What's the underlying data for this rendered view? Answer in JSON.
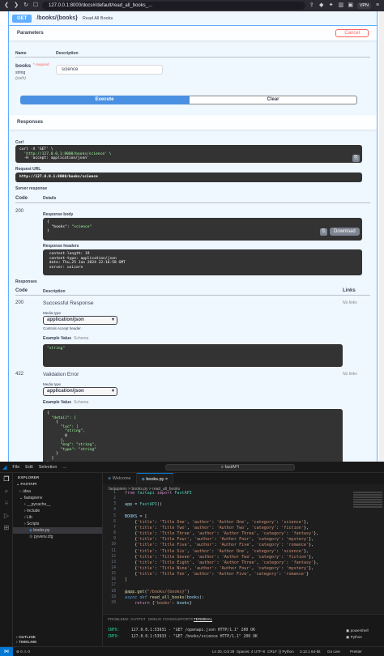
{
  "browser": {
    "url": "127.0.0.1:8000/docs#/default/read_all_books_...",
    "vpn": "VPN"
  },
  "operation": {
    "method": "GET",
    "path": "/books/{books}",
    "summary": "Read All Books"
  },
  "parameters": {
    "title": "Parameters",
    "cancel_label": "Cancel",
    "col_name": "Name",
    "col_description": "Description",
    "param_name": "books",
    "param_required": "* required",
    "param_type": "string",
    "param_in": "(path)",
    "param_value": "science",
    "execute_label": "Execute",
    "clear_label": "Clear"
  },
  "responses_section": {
    "title": "Responses",
    "curl_label": "Curl",
    "curl_line1": "curl -X 'GET' \\",
    "curl_line2": "  'http://127.0.0.1:8000/books/science' \\",
    "curl_line3": "  -H 'accept: application/json'",
    "request_url_label": "Request URL",
    "request_url": "http://127.0.0.1:8000/books/science",
    "server_response_label": "Server response",
    "col_code": "Code",
    "col_details": "Details",
    "code": "200",
    "response_body_label": "Response body",
    "body_line1": "{",
    "body_line2_key": "  \"books\": ",
    "body_line2_val": "\"science\"",
    "body_line3": "}",
    "download_label": "Download",
    "response_headers_label": "Response headers",
    "headers": [
      " content-length: 19",
      " content-type: application/json",
      " date: Thu,25 Jan 2024 22:16:58 GMT",
      " server: uvicorn"
    ]
  },
  "documented_responses": {
    "title": "Responses",
    "col_code": "Code",
    "col_description": "Description",
    "col_links": "Links",
    "r200_code": "200",
    "r200_desc": "Successful Response",
    "r200_links": "No links",
    "media_type_label": "Media type",
    "media_type_value": "application/json",
    "controls_accept": "Controls Accept header.",
    "example_value_label": "Example Value",
    "schema_label": "Schema",
    "r200_example": "\"string\"",
    "r422_code": "422",
    "r422_desc": "Validation Error",
    "r422_links": "No links",
    "r422_example_lines": [
      "{",
      "  \"detail\": [",
      "    {",
      "      \"loc\": [",
      "        \"string\",",
      "        0",
      "      ],",
      "      \"msg\": \"string\",",
      "      \"type\": \"string\"",
      "    }",
      "  ]",
      "}"
    ]
  },
  "vscode": {
    "menu": [
      "File",
      "Edit",
      "Selection",
      "..."
    ],
    "command_center": "fastAPI",
    "explorer_title": "EXPLORER",
    "project": "FASTAPI",
    "tree": [
      ".idea",
      "fastapienv",
      "__pycache__",
      "Include",
      "Lib",
      "Scripts",
      "books.py",
      "pyvenv.cfg"
    ],
    "outline": "OUTLINE",
    "timeline": "TIMELINE",
    "tabs": [
      "Welcome",
      "books.py"
    ],
    "breadcrumb": "fastapienv > books.py > read_all_books",
    "code_lines": [
      {
        "n": "1",
        "parts": [
          [
            "kw",
            "from "
          ],
          [
            "cls",
            "fastapi "
          ],
          [
            "kw",
            "import "
          ],
          [
            "cls",
            "FastAPI"
          ]
        ]
      },
      {
        "n": "2",
        "parts": []
      },
      {
        "n": "3",
        "parts": [
          [
            "vr",
            "app "
          ],
          [
            "op",
            "= "
          ],
          [
            "cls",
            "FastAPI"
          ],
          [
            "op",
            "()"
          ]
        ]
      },
      {
        "n": "4",
        "parts": []
      },
      {
        "n": "5",
        "parts": [
          [
            "vr",
            "BOOKS "
          ],
          [
            "op",
            "= ["
          ]
        ]
      },
      {
        "n": "6",
        "parts": [
          [
            "op",
            "    {"
          ],
          [
            "s",
            "'title'"
          ],
          [
            "op",
            ": "
          ],
          [
            "s",
            "'Title One'"
          ],
          [
            "op",
            ", "
          ],
          [
            "s",
            "'author'"
          ],
          [
            "op",
            ": "
          ],
          [
            "s",
            "'Author One'"
          ],
          [
            "op",
            ", "
          ],
          [
            "s",
            "'category'"
          ],
          [
            "op",
            ": "
          ],
          [
            "s",
            "'science'"
          ],
          [
            "op",
            "},"
          ]
        ]
      },
      {
        "n": "7",
        "parts": [
          [
            "op",
            "    {"
          ],
          [
            "s",
            "'title'"
          ],
          [
            "op",
            ": "
          ],
          [
            "s",
            "'Title Two'"
          ],
          [
            "op",
            ", "
          ],
          [
            "s",
            "'author'"
          ],
          [
            "op",
            ": "
          ],
          [
            "s",
            "'Author Two'"
          ],
          [
            "op",
            ", "
          ],
          [
            "s",
            "'category'"
          ],
          [
            "op",
            ": "
          ],
          [
            "s",
            "'fiction'"
          ],
          [
            "op",
            "},"
          ]
        ]
      },
      {
        "n": "8",
        "parts": [
          [
            "op",
            "    {"
          ],
          [
            "s",
            "'title'"
          ],
          [
            "op",
            ": "
          ],
          [
            "s",
            "'Title Three'"
          ],
          [
            "op",
            ", "
          ],
          [
            "s",
            "'author'"
          ],
          [
            "op",
            ": "
          ],
          [
            "s",
            "'Author Three'"
          ],
          [
            "op",
            ", "
          ],
          [
            "s",
            "'category'"
          ],
          [
            "op",
            ": "
          ],
          [
            "s",
            "'fantasy'"
          ],
          [
            "op",
            "},"
          ]
        ]
      },
      {
        "n": "9",
        "parts": [
          [
            "op",
            "    {"
          ],
          [
            "s",
            "'title'"
          ],
          [
            "op",
            ": "
          ],
          [
            "s",
            "'Title Four'"
          ],
          [
            "op",
            ", "
          ],
          [
            "s",
            "'author'"
          ],
          [
            "op",
            ": "
          ],
          [
            "s",
            "'Author Four'"
          ],
          [
            "op",
            ", "
          ],
          [
            "s",
            "'category'"
          ],
          [
            "op",
            ": "
          ],
          [
            "s",
            "'mystery'"
          ],
          [
            "op",
            "},"
          ]
        ]
      },
      {
        "n": "10",
        "parts": [
          [
            "op",
            "    {"
          ],
          [
            "s",
            "'title'"
          ],
          [
            "op",
            ": "
          ],
          [
            "s",
            "'Title Five'"
          ],
          [
            "op",
            ", "
          ],
          [
            "s",
            "'author'"
          ],
          [
            "op",
            ": "
          ],
          [
            "s",
            "'Author Five'"
          ],
          [
            "op",
            ", "
          ],
          [
            "s",
            "'category'"
          ],
          [
            "op",
            ": "
          ],
          [
            "s",
            "'romance'"
          ],
          [
            "op",
            "},"
          ]
        ]
      },
      {
        "n": "11",
        "parts": [
          [
            "op",
            "    {"
          ],
          [
            "s",
            "'title'"
          ],
          [
            "op",
            ": "
          ],
          [
            "s",
            "'Title Six'"
          ],
          [
            "op",
            ", "
          ],
          [
            "s",
            "'author'"
          ],
          [
            "op",
            ": "
          ],
          [
            "s",
            "'Author One'"
          ],
          [
            "op",
            ", "
          ],
          [
            "s",
            "'category'"
          ],
          [
            "op",
            ": "
          ],
          [
            "s",
            "'science'"
          ],
          [
            "op",
            "},"
          ]
        ]
      },
      {
        "n": "12",
        "parts": [
          [
            "op",
            "    {"
          ],
          [
            "s",
            "'title'"
          ],
          [
            "op",
            ": "
          ],
          [
            "s",
            "'Title Seven'"
          ],
          [
            "op",
            ", "
          ],
          [
            "s",
            "'author'"
          ],
          [
            "op",
            ": "
          ],
          [
            "s",
            "'Author Two'"
          ],
          [
            "op",
            ", "
          ],
          [
            "s",
            "'category'"
          ],
          [
            "op",
            ": "
          ],
          [
            "s",
            "'fiction'"
          ],
          [
            "op",
            "},"
          ]
        ]
      },
      {
        "n": "13",
        "parts": [
          [
            "op",
            "    {"
          ],
          [
            "s",
            "'title'"
          ],
          [
            "op",
            ": "
          ],
          [
            "s",
            "'Title Eight'"
          ],
          [
            "op",
            ", "
          ],
          [
            "s",
            "'author'"
          ],
          [
            "op",
            ": "
          ],
          [
            "s",
            "'Author Three'"
          ],
          [
            "op",
            ", "
          ],
          [
            "s",
            "'category'"
          ],
          [
            "op",
            ": "
          ],
          [
            "s",
            "'fantasy'"
          ],
          [
            "op",
            "},"
          ]
        ]
      },
      {
        "n": "14",
        "parts": [
          [
            "op",
            "    {"
          ],
          [
            "s",
            "'title'"
          ],
          [
            "op",
            ": "
          ],
          [
            "s",
            "'Title Nine'"
          ],
          [
            "op",
            ", "
          ],
          [
            "s",
            "'author'"
          ],
          [
            "op",
            ": "
          ],
          [
            "s",
            "'Author Four'"
          ],
          [
            "op",
            ", "
          ],
          [
            "s",
            "'category'"
          ],
          [
            "op",
            ": "
          ],
          [
            "s",
            "'mystery'"
          ],
          [
            "op",
            "},"
          ]
        ]
      },
      {
        "n": "15",
        "parts": [
          [
            "op",
            "    {"
          ],
          [
            "s",
            "'title'"
          ],
          [
            "op",
            ": "
          ],
          [
            "s",
            "'Title Ten'"
          ],
          [
            "op",
            ", "
          ],
          [
            "s",
            "'author'"
          ],
          [
            "op",
            ": "
          ],
          [
            "s",
            "'Author Five'"
          ],
          [
            "op",
            ", "
          ],
          [
            "s",
            "'category'"
          ],
          [
            "op",
            ": "
          ],
          [
            "s",
            "'romance'"
          ],
          [
            "op",
            "}"
          ]
        ]
      },
      {
        "n": "16",
        "parts": [
          [
            "op",
            "]"
          ]
        ]
      },
      {
        "n": "17",
        "parts": []
      },
      {
        "n": "18",
        "parts": [
          [
            "dec",
            "@app.get"
          ],
          [
            "op",
            "("
          ],
          [
            "s",
            "\"/books/{books}\""
          ],
          [
            "op",
            ")"
          ]
        ]
      },
      {
        "n": "19",
        "parts": [
          [
            "kb",
            "async def "
          ],
          [
            "fn",
            "read_all_books"
          ],
          [
            "op",
            "("
          ],
          [
            "vr",
            "books"
          ],
          [
            "op",
            "):"
          ]
        ]
      },
      {
        "n": "20",
        "parts": [
          [
            "kw",
            "    return "
          ],
          [
            "op",
            "{"
          ],
          [
            "s",
            "'books'"
          ],
          [
            "op",
            ": "
          ],
          [
            "vr",
            "books"
          ],
          [
            "op",
            "}"
          ]
        ]
      }
    ],
    "panel_tabs": [
      "PROBLEMS",
      "OUTPUT",
      "DEBUG CONSOLE",
      "PORTS",
      "TERMINAL"
    ],
    "terminal_lines": [
      [
        "INFO:",
        "     127.0.0.1:53931 - \"GET /openapi.json HTTP/1.1\" 200 OK"
      ],
      [
        "INFO:",
        "     127.0.0.1:53933 - \"GET /books/science HTTP/1.1\" 200 OK"
      ]
    ],
    "terminal_shell": "powershell",
    "terminal_python": "Python",
    "status_items": [
      "⊗ 0  ⚠ 0",
      "Ln 20, Col 28",
      "Spaces: 4",
      "UTF-8",
      "CRLF",
      "{} Python",
      "3.12.1 64-bit",
      "Go Live",
      "Prettier"
    ]
  }
}
